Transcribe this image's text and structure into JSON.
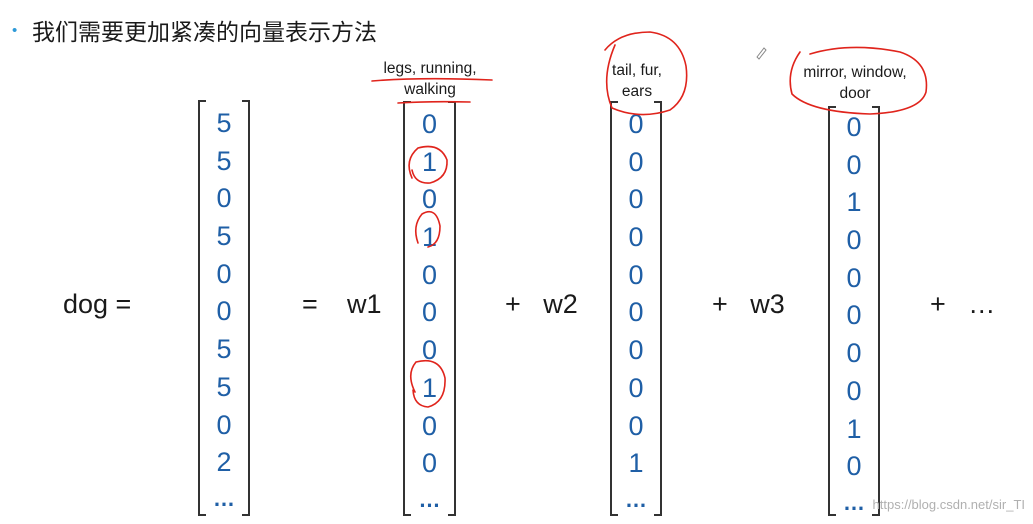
{
  "slide": {
    "title": "我们需要更加紧凑的向量表示方法",
    "bullet": "•"
  },
  "equation": {
    "lhs": "dog =",
    "equals": "=",
    "terms": [
      {
        "prefix": "w1",
        "label": "legs, running, walking"
      },
      {
        "prefix": "+   w2",
        "label": "tail, fur, ears"
      },
      {
        "prefix": "+   w3",
        "label": "mirror, window, door"
      }
    ],
    "trailing": "+   …"
  },
  "vectors": {
    "dog": [
      "5",
      "5",
      "0",
      "5",
      "0",
      "0",
      "5",
      "5",
      "0",
      "2",
      "…"
    ],
    "v1": [
      "0",
      "1",
      "0",
      "1",
      "0",
      "0",
      "0",
      "1",
      "0",
      "0",
      "…"
    ],
    "v2": [
      "0",
      "0",
      "0",
      "0",
      "0",
      "0",
      "0",
      "0",
      "0",
      "1",
      "…"
    ],
    "v3": [
      "0",
      "0",
      "1",
      "0",
      "0",
      "0",
      "0",
      "0",
      "1",
      "0",
      "…"
    ]
  },
  "labels": {
    "v1_line1": "legs, running,",
    "v1_line2": "walking",
    "v2_line1": "tail, fur,",
    "v2_line2": "ears",
    "v3_line1": "mirror, window,",
    "v3_line2": "door"
  },
  "watermark": "https://blog.csdn.net/sir_TI",
  "colors": {
    "value": "#1f5fa6",
    "annotation": "#e0241c",
    "bullet": "#2e9ad8"
  }
}
